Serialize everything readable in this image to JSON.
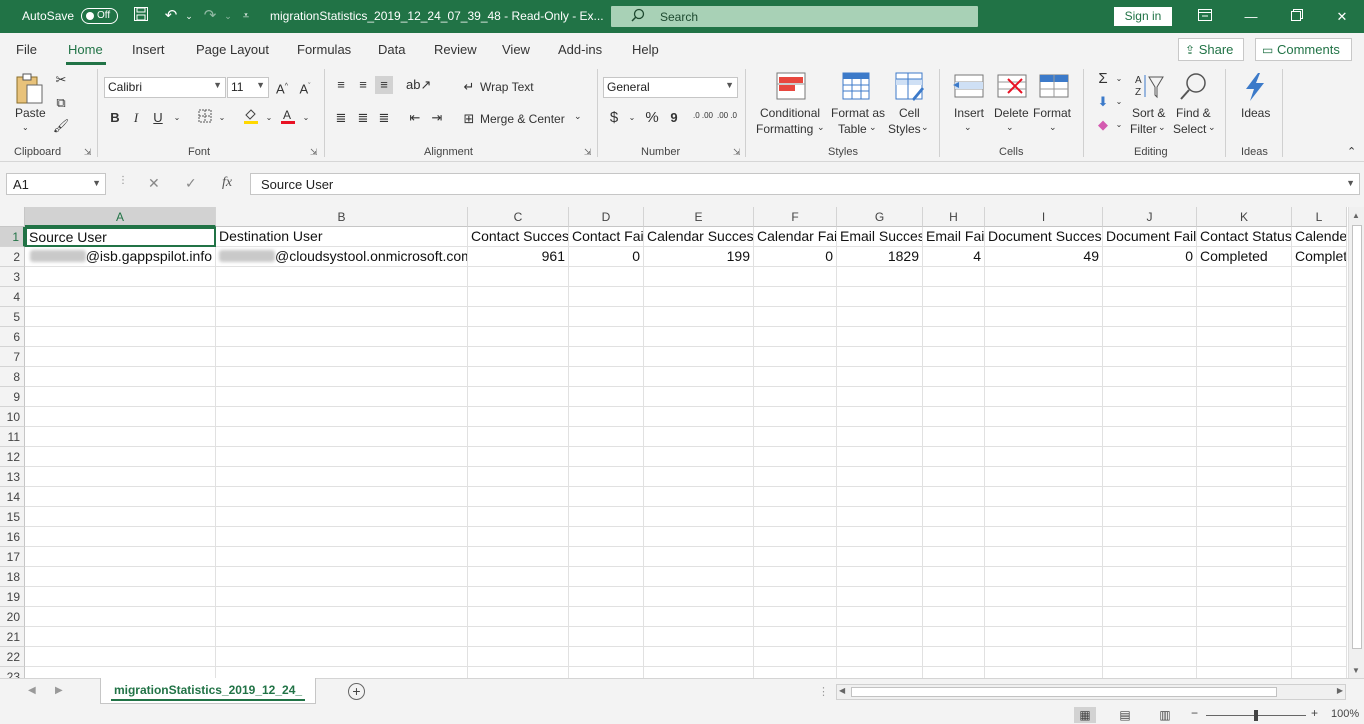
{
  "titlebar": {
    "autosave_label": "AutoSave",
    "autosave_state": "Off",
    "doc_title": "migrationStatistics_2019_12_24_07_39_48  -  Read-Only  -  Ex...",
    "search_placeholder": "Search",
    "signin_label": "Sign in",
    "icons": [
      "save-icon",
      "undo-icon",
      "redo-icon",
      "customize-icon",
      "ribbon-display-icon",
      "minimize-icon",
      "restore-icon",
      "close-icon"
    ]
  },
  "menu": {
    "tabs": [
      "File",
      "Home",
      "Insert",
      "Page Layout",
      "Formulas",
      "Data",
      "Review",
      "View",
      "Add-ins",
      "Help"
    ],
    "active": "Home",
    "share_label": "Share",
    "comments_label": "Comments"
  },
  "ribbon": {
    "clipboard": {
      "paste": "Paste",
      "label": "Clipboard"
    },
    "font": {
      "name": "Calibri",
      "size": "11",
      "label": "Font",
      "bold": "B",
      "italic": "I",
      "underline": "U"
    },
    "alignment": {
      "wrap_text": "Wrap Text",
      "merge_center": "Merge & Center",
      "label": "Alignment"
    },
    "number": {
      "format": "General",
      "currency": "$",
      "percent": "%",
      "comma": "9",
      "inc_dec": ".0 .00",
      "dec_dec": ".00 .0",
      "label": "Number"
    },
    "styles": {
      "conditional_1": "Conditional",
      "conditional_2": "Formatting",
      "format_table_1": "Format as",
      "format_table_2": "Table",
      "cell_styles_1": "Cell",
      "cell_styles_2": "Styles",
      "label": "Styles"
    },
    "cells": {
      "insert": "Insert",
      "delete": "Delete",
      "format": "Format",
      "label": "Cells"
    },
    "editing": {
      "sort_1": "Sort &",
      "sort_2": "Filter",
      "find_1": "Find &",
      "find_2": "Select",
      "label": "Editing"
    },
    "ideas": {
      "btn": "Ideas",
      "label": "Ideas"
    }
  },
  "formula_bar": {
    "name_box": "A1",
    "fx": "fx",
    "content": "Source User"
  },
  "grid": {
    "columns": [
      "A",
      "B",
      "C",
      "D",
      "E",
      "F",
      "G",
      "H",
      "I",
      "J",
      "K",
      "L"
    ],
    "rows": [
      "1",
      "2",
      "3",
      "4",
      "5",
      "6",
      "7",
      "8",
      "9",
      "10",
      "11",
      "12",
      "13",
      "14",
      "15",
      "16",
      "17",
      "18",
      "19",
      "20",
      "21",
      "22",
      "23"
    ],
    "header_row": [
      "Source User",
      "Destination User",
      "Contact Success",
      "Contact Fail",
      "Calendar Success",
      "Calendar Fail",
      "Email Success",
      "Email Fail",
      "Document Success",
      "Document Fail",
      "Contact Status",
      "Calende"
    ],
    "data_row": [
      "@isb.gappspilot.info",
      "@cloudsystool.onmicrosoft.com",
      "961",
      "0",
      "199",
      "0",
      "1829",
      "4",
      "49",
      "0",
      "Completed",
      "Complet"
    ]
  },
  "sheet_tabs": {
    "active": "migrationStatistics_2019_12_24_"
  },
  "statusbar": {
    "zoom": "100%",
    "zoom_level_percent": 100,
    "views": [
      "normal-view-icon",
      "page-layout-view-icon",
      "page-break-preview-icon"
    ]
  },
  "colors": {
    "accent": "#217346",
    "ribbon_bg": "#f3f3f3",
    "search_bg": "#a8d1b6"
  }
}
